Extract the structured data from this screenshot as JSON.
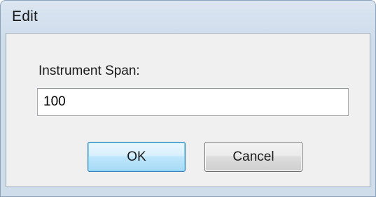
{
  "window": {
    "title": "Edit"
  },
  "form": {
    "label": "Instrument Span:",
    "value": "100"
  },
  "buttons": {
    "ok_label": "OK",
    "cancel_label": "Cancel"
  }
}
